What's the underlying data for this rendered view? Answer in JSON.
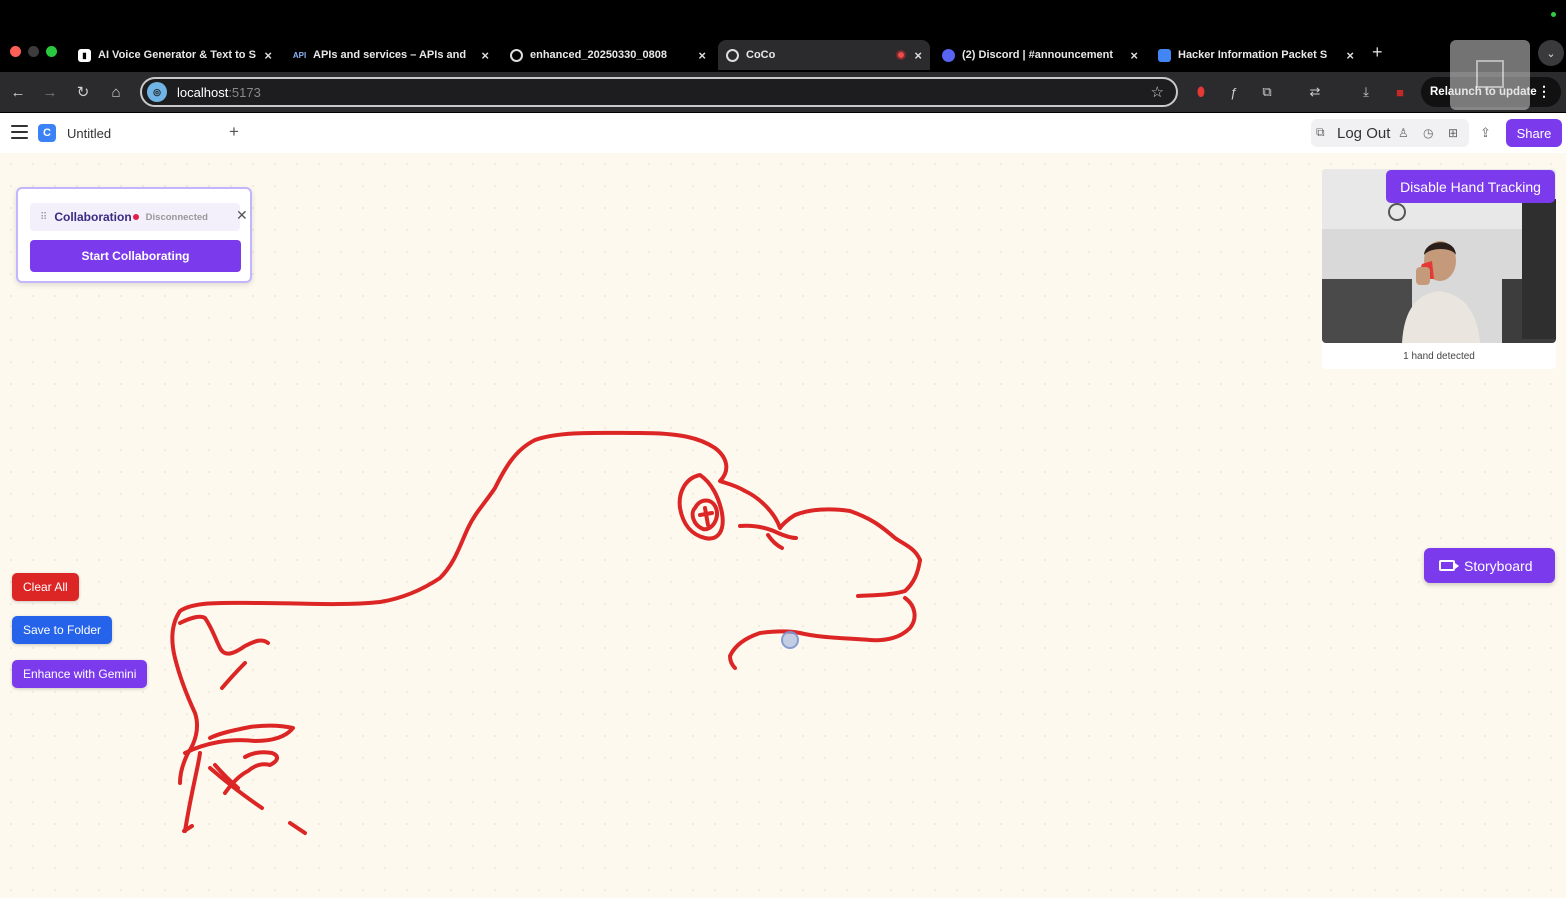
{
  "browser": {
    "tabs": [
      {
        "title": "AI Voice Generator & Text to S",
        "favicon": "doc-icon"
      },
      {
        "title": "APIs and services – APIs and",
        "favicon": "api-icon"
      },
      {
        "title": "enhanced_20250330_0808",
        "favicon": "globe-icon"
      },
      {
        "title": "CoCo",
        "favicon": "globe-icon",
        "active": true,
        "recording": true
      },
      {
        "title": "(2) Discord | #announcement",
        "favicon": "discord-icon"
      },
      {
        "title": "Hacker Information Packet S",
        "favicon": "docs-icon"
      }
    ],
    "url": {
      "host": "localhost",
      "port": ":5173"
    },
    "relaunch_label": "Relaunch to update"
  },
  "app": {
    "doc_title": "Untitled",
    "logo_letter": "C",
    "logout_label": "Log Out",
    "share_label": "Share"
  },
  "collab": {
    "title": "Collaboration",
    "status": "Disconnected",
    "start_label": "Start Collaborating"
  },
  "actions": {
    "clear_label": "Clear All",
    "save_label": "Save to Folder",
    "enhance_label": "Enhance with Gemini"
  },
  "camera": {
    "disable_label": "Disable Hand Tracking",
    "caption": "1 hand detected"
  },
  "storyboard_label": "Storyboard",
  "colors": {
    "accent": "#7c3aed",
    "clear": "#dc2626",
    "save": "#2563eb",
    "stroke": "#dc2626",
    "canvas": "#fdf9ee"
  }
}
